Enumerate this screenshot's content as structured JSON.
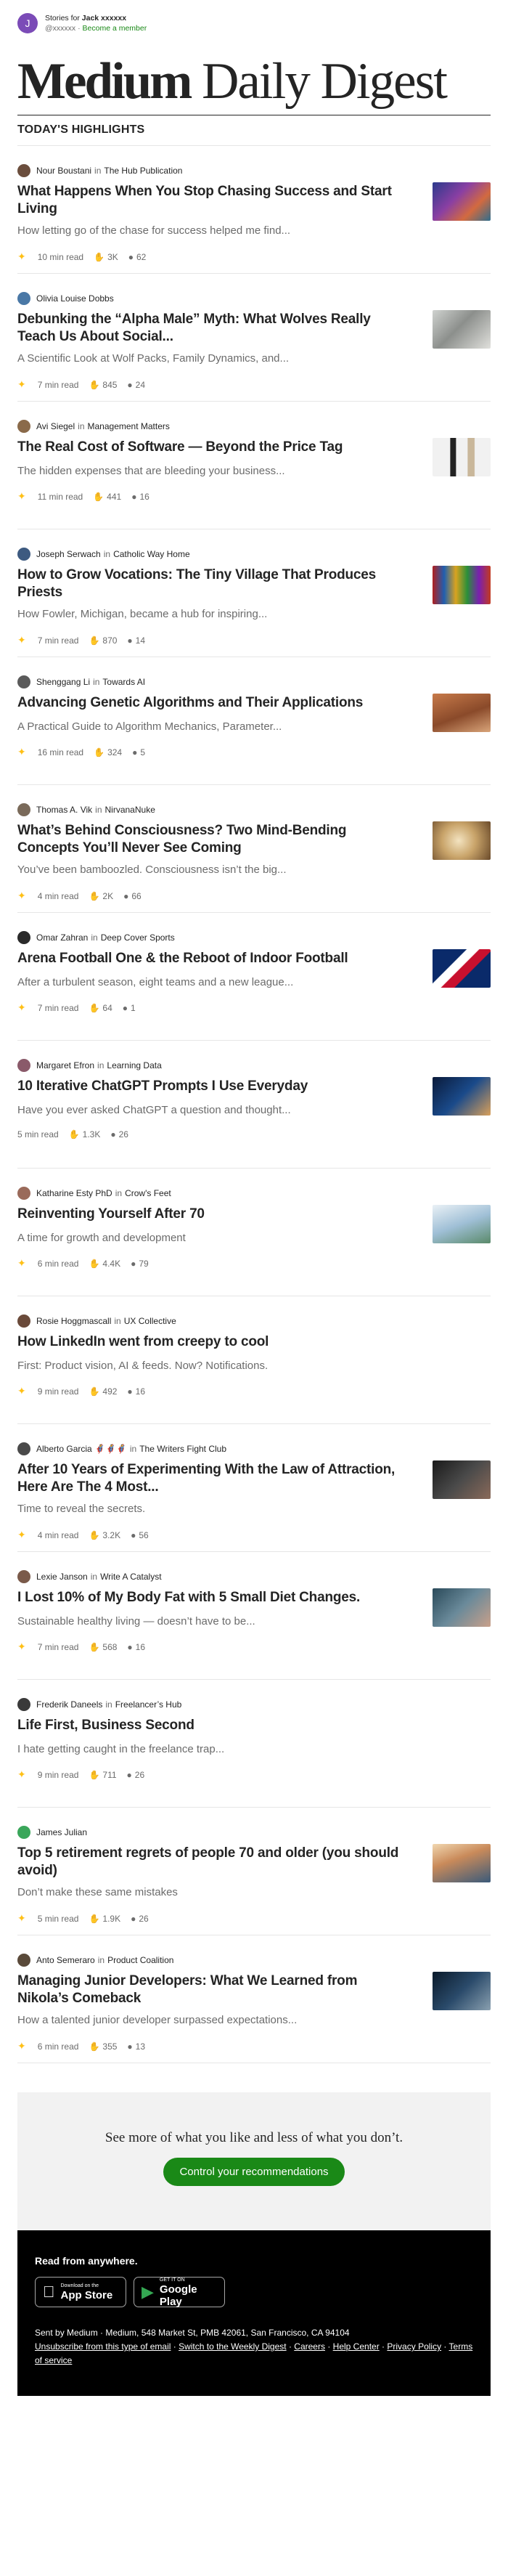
{
  "account": {
    "avatar_letter": "J",
    "stories_for": "Stories for",
    "username": "Jack xxxxxx",
    "handle": "@xxxxxx",
    "separator": "·",
    "become_member": "Become a member"
  },
  "masthead": {
    "brand": "Medium",
    "rest": "Daily Digest"
  },
  "section_title": "TODAY'S HIGHLIGHTS",
  "in_word": "in",
  "articles": [
    {
      "author": "Nour Boustani",
      "publication": "The Hub Publication",
      "title": "What Happens When You Stop Chasing Success and Start Living",
      "subtitle": "How letting go of the chase for success helped me find...",
      "read_time": "10 min read",
      "claps": "3K",
      "comments": "62",
      "starred": true,
      "avatar_color": "#6b4e3d",
      "thumb": "linear-gradient(135deg,#2b3a8c,#8a3fa3 40%,#d36a3f 70%,#2f6e8e)"
    },
    {
      "author": "Olivia Louise Dobbs",
      "publication": "",
      "title": "Debunking the “Alpha Male” Myth: What Wolves Really Teach Us About Social...",
      "subtitle": "A Scientific Look at Wolf Packs, Family Dynamics, and...",
      "read_time": "7 min read",
      "claps": "845",
      "comments": "24",
      "starred": true,
      "avatar_color": "#4a78a6",
      "thumb": "linear-gradient(135deg,#cfd2cf,#8c8f8c 45%,#e0e0dc)"
    },
    {
      "author": "Avi Siegel",
      "publication": "Management Matters",
      "title": "The Real Cost of Software — Beyond the Price Tag",
      "subtitle": "The hidden expenses that are bleeding your business...",
      "read_time": "11 min read",
      "claps": "441",
      "comments": "16",
      "starred": true,
      "avatar_color": "#8a6a4a",
      "thumb": "linear-gradient(90deg,#f1f1f1 0%,#f1f1f1 30%,#222 31%,#222 40%,#f1f1f1 41%,#f1f1f1 60%,#c9b79a 61%,#c9b79a 72%,#f1f1f1 73%)"
    },
    {
      "author": "Joseph Serwach",
      "publication": "Catholic Way Home",
      "title": "How to Grow Vocations: The Tiny Village That Produces Priests",
      "subtitle": "How Fowler, Michigan, became a hub for inspiring...",
      "read_time": "7 min read",
      "claps": "870",
      "comments": "14",
      "starred": true,
      "avatar_color": "#3d5a80",
      "thumb": "linear-gradient(90deg,#b01f1f,#1f5fb0 20%,#d9a31f 40%,#2a8f3a 60%,#7a1fb0 80%,#c23a1f)"
    },
    {
      "author": "Shenggang Li",
      "publication": "Towards AI",
      "title": "Advancing Genetic Algorithms and Their Applications",
      "subtitle": "A Practical Guide to Algorithm Mechanics, Parameter...",
      "read_time": "16 min read",
      "claps": "324",
      "comments": "5",
      "starred": true,
      "avatar_color": "#5a5a5a",
      "thumb": "linear-gradient(160deg,#c77a4a,#8a4a2a 55%,#d9a57a)"
    },
    {
      "author": "Thomas A. Vik",
      "publication": "NirvanaNuke",
      "title": "What’s Behind Consciousness? Two Mind-Bending Concepts You’ll Never See Coming",
      "subtitle": "You’ve been bamboozled. Consciousness isn’t the big...",
      "read_time": "4 min read",
      "claps": "2K",
      "comments": "66",
      "starred": true,
      "avatar_color": "#7a6a5a",
      "thumb": "radial-gradient(circle at 45% 50%,#f3e3c0,#c9a46a 45%,#6a4a2a)"
    },
    {
      "author": "Omar Zahran",
      "publication": "Deep Cover Sports",
      "title": "Arena Football One & the Reboot of Indoor Football",
      "subtitle": "After a turbulent season, eight teams and a new league...",
      "read_time": "7 min read",
      "claps": "64",
      "comments": "1",
      "starred": true,
      "avatar_color": "#2a2a2a",
      "thumb": "linear-gradient(135deg,#0a2a6a 0%,#0a2a6a 35%,#ffffff 36%,#ffffff 48%,#c8102e 49%,#c8102e 62%,#0a2a6a 63%)"
    },
    {
      "author": "Margaret Efron",
      "publication": "Learning Data",
      "title": "10 Iterative ChatGPT Prompts I Use Everyday",
      "subtitle": "Have you ever asked ChatGPT a question and thought...",
      "read_time": "5 min read",
      "claps": "1.3K",
      "comments": "26",
      "starred": false,
      "avatar_color": "#8a5a6a",
      "thumb": "linear-gradient(135deg,#0a1a3a,#1a4a8a 50%,#d9a05a)"
    },
    {
      "author": "Katharine Esty PhD",
      "publication": "Crow's Feet",
      "title": "Reinventing Yourself After 70",
      "subtitle": "A time for growth and development",
      "read_time": "6 min read",
      "claps": "4.4K",
      "comments": "79",
      "starred": true,
      "avatar_color": "#9a6a5a",
      "thumb": "linear-gradient(160deg,#eaf1f6,#9fbfd6 50%,#5a8a6a)"
    },
    {
      "author": "Rosie Hoggmascall",
      "publication": "UX Collective",
      "title": "How LinkedIn went from creepy to cool",
      "subtitle": "First: Product vision, AI & feeds. Now? Notifications.",
      "read_time": "9 min read",
      "claps": "492",
      "comments": "16",
      "starred": true,
      "avatar_color": "#6a4a3a",
      "thumb": "linear-gradient(#ffffff,#ffffff)"
    },
    {
      "author": "Alberto Garcia 🦸🦸🦸",
      "publication": "The Writers Fight Club",
      "title": "After 10 Years of Experimenting With the Law of Attraction, Here Are The 4 Most...",
      "subtitle": "Time to reveal the secrets.",
      "read_time": "4 min read",
      "claps": "3.2K",
      "comments": "56",
      "starred": true,
      "avatar_color": "#4a4a4a",
      "thumb": "linear-gradient(135deg,#1a1a1a,#4a4a4a 50%,#8a6a5a)"
    },
    {
      "author": "Lexie Janson",
      "publication": "Write A Catalyst",
      "title": "I Lost 10% of My Body Fat with 5 Small Diet Changes.",
      "subtitle": "Sustainable healthy living — doesn’t have to be...",
      "read_time": "7 min read",
      "claps": "568",
      "comments": "16",
      "starred": true,
      "avatar_color": "#7a5a4a",
      "thumb": "linear-gradient(135deg,#2a4a5a,#6a8a9a 50%,#c9a08a)"
    },
    {
      "author": "Frederik Daneels",
      "publication": "Freelancer’s Hub",
      "title": "Life First, Business Second",
      "subtitle": "I hate getting caught in the freelance trap...",
      "read_time": "9 min read",
      "claps": "711",
      "comments": "26",
      "starred": true,
      "avatar_color": "#3a3a3a",
      "thumb": "linear-gradient(#ffffff,#ffffff)"
    },
    {
      "author": "James Julian",
      "publication": "",
      "title": "Top 5 retirement regrets of people 70 and older (you should avoid)",
      "subtitle": "Don’t make these same mistakes",
      "read_time": "5 min read",
      "claps": "1.9K",
      "comments": "26",
      "starred": true,
      "avatar_color": "#3aa65a",
      "thumb": "linear-gradient(160deg,#f1d7b0,#c98a5a 40%,#3a5a7a)"
    },
    {
      "author": "Anto Semeraro",
      "publication": "Product Coalition",
      "title": "Managing Junior Developers: What We Learned from Nikola’s Comeback",
      "subtitle": "How a talented junior developer surpassed expectations...",
      "read_time": "6 min read",
      "claps": "355",
      "comments": "13",
      "starred": true,
      "avatar_color": "#5a4a3a",
      "thumb": "linear-gradient(135deg,#0a1a2a,#2a4a6a 50%,#8aa0b0)"
    }
  ],
  "recommendations": {
    "text": "See more of what you like and less of what you don’t.",
    "button": "Control your recommendations"
  },
  "footer": {
    "read_anywhere": "Read from anywhere.",
    "app_store_small": "Download on the",
    "app_store_big": "App Store",
    "google_small": "GET IT ON",
    "google_big": "Google Play",
    "sent_by": "Sent by Medium · Medium, 548 Market St, PMB 42061, San Francisco, CA 94104",
    "unsubscribe": "Unsubscribe from this type of email",
    "weekly": "Switch to the Weekly Digest",
    "careers": "Careers",
    "help": "Help Center",
    "privacy": "Privacy Policy",
    "terms": "Terms of service",
    "dot": "·"
  },
  "colors": {
    "accent_green": "#1a8917",
    "star": "#ffc017",
    "avatar": "#7b4bb7"
  }
}
